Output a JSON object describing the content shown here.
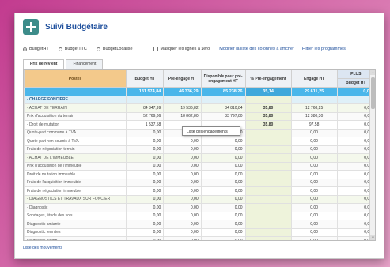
{
  "app": {
    "title": "Suivi Budgétaire"
  },
  "controls": {
    "radios": [
      {
        "label": "BudgetHT",
        "checked": true
      },
      {
        "label": "BudgetTTC",
        "checked": false
      },
      {
        "label": "BudgetLocalisé",
        "checked": false
      }
    ],
    "hide_zero_label": "Masquer les lignes à zéro",
    "modify_columns_link": "Modifier la liste des colonnes à afficher",
    "filter_programs_link": "Filtrer les programmes"
  },
  "tabs": [
    "Prix de revient",
    "Financement"
  ],
  "grid": {
    "headers": {
      "postes": "Postes",
      "budget_ht": "Budget HT",
      "pre_engage_ht": "Pré-engagé HT",
      "disponible": "Disponible pour pré-engagement HT",
      "pct_pre_engagement": "% Pré-engagement",
      "engage_ht": "Engagé HT",
      "plus": "PLUS",
      "plus_budget_ht": "Budget HT"
    },
    "total": {
      "label": "",
      "budget": "131 574,84",
      "pre": "46 336,29",
      "dispo": "85 238,26",
      "pct": "35,14",
      "engage": "29 611,25",
      "plus": "0,00"
    },
    "rows": [
      {
        "level": "lvl0",
        "label": "- CHARGE FONCIERE",
        "budget": "",
        "pre": "",
        "dispo": "",
        "pct": "",
        "engage": "",
        "plus": ""
      },
      {
        "level": "lvl1",
        "label": "- ACHAT DE TERRAIN",
        "budget": "84 347,99",
        "pre": "19 536,82",
        "dispo": "34 810,84",
        "pct": "35,80",
        "engage": "12 768,25",
        "plus": "0,00"
      },
      {
        "level": "alt",
        "label": "Prix d'acquisition du terrain",
        "budget": "52 769,86",
        "pre": "18 862,80",
        "dispo": "33 797,80",
        "pct": "35,80",
        "engage": "12 380,30",
        "plus": "0,00"
      },
      {
        "level": "",
        "label": "- Droit de mutation",
        "budget": "1 537,58",
        "pre": "",
        "dispo": "",
        "pct": "35,80",
        "engage": "97,58",
        "plus": "0,00"
      },
      {
        "level": "alt",
        "label": "Quote-part commune à TVA",
        "budget": "0,00",
        "pre": "0,00",
        "dispo": "0,00",
        "pct": "",
        "engage": "0,00",
        "plus": "0,00"
      },
      {
        "level": "",
        "label": "Quote-part non soumis à TVA",
        "budget": "0,00",
        "pre": "0,00",
        "dispo": "0,00",
        "pct": "",
        "engage": "0,00",
        "plus": "0,00"
      },
      {
        "level": "alt",
        "label": "Frais de négociation terrain",
        "budget": "0,00",
        "pre": "0,00",
        "dispo": "0,00",
        "pct": "",
        "engage": "0,00",
        "plus": "0,00"
      },
      {
        "level": "lvl1",
        "label": "- ACHAT DE L'IMMEUBLE",
        "budget": "0,00",
        "pre": "0,00",
        "dispo": "0,00",
        "pct": "",
        "engage": "0,00",
        "plus": "0,00"
      },
      {
        "level": "alt",
        "label": "Prix d'acquisition de l'immeuble",
        "budget": "0,00",
        "pre": "0,00",
        "dispo": "0,00",
        "pct": "",
        "engage": "0,00",
        "plus": "0,00"
      },
      {
        "level": "",
        "label": "Droit de mutation immeuble",
        "budget": "0,00",
        "pre": "0,00",
        "dispo": "0,00",
        "pct": "",
        "engage": "0,00",
        "plus": "0,00"
      },
      {
        "level": "alt",
        "label": "Frais de l'acquisition immeuble",
        "budget": "0,00",
        "pre": "0,00",
        "dispo": "0,00",
        "pct": "",
        "engage": "0,00",
        "plus": "0,00"
      },
      {
        "level": "",
        "label": "Frais de négociation immeuble",
        "budget": "0,00",
        "pre": "0,00",
        "dispo": "0,00",
        "pct": "",
        "engage": "0,00",
        "plus": "0,00"
      },
      {
        "level": "lvl1",
        "label": "- DIAGNOSTICS ET TRAVAUX SUR FONCIER",
        "budget": "0,00",
        "pre": "0,00",
        "dispo": "0,00",
        "pct": "",
        "engage": "0,00",
        "plus": "0,00"
      },
      {
        "level": "alt",
        "label": "- Diagnostic",
        "budget": "0,00",
        "pre": "0,00",
        "dispo": "0,00",
        "pct": "",
        "engage": "0,00",
        "plus": "0,00"
      },
      {
        "level": "",
        "label": "Sondages, étude des sols",
        "budget": "0,00",
        "pre": "0,00",
        "dispo": "0,00",
        "pct": "",
        "engage": "0,00",
        "plus": "0,00"
      },
      {
        "level": "alt",
        "label": "Diagnostic amiante",
        "budget": "0,00",
        "pre": "0,00",
        "dispo": "0,00",
        "pct": "",
        "engage": "0,00",
        "plus": "0,00"
      },
      {
        "level": "",
        "label": "Diagnostic termites",
        "budget": "0,00",
        "pre": "0,00",
        "dispo": "0,00",
        "pct": "",
        "engage": "0,00",
        "plus": "0,00"
      },
      {
        "level": "alt",
        "label": "Diagnostic plomb",
        "budget": "0,00",
        "pre": "0,00",
        "dispo": "0,00",
        "pct": "",
        "engage": "0,00",
        "plus": "0,00"
      }
    ]
  },
  "popup": {
    "label": "Liste des engagements"
  },
  "footer": {
    "link": "Liste des mouvements"
  },
  "colors": {
    "accent": "#4ab6ea",
    "title": "#1e4f9c",
    "background": "#c23b8f"
  }
}
